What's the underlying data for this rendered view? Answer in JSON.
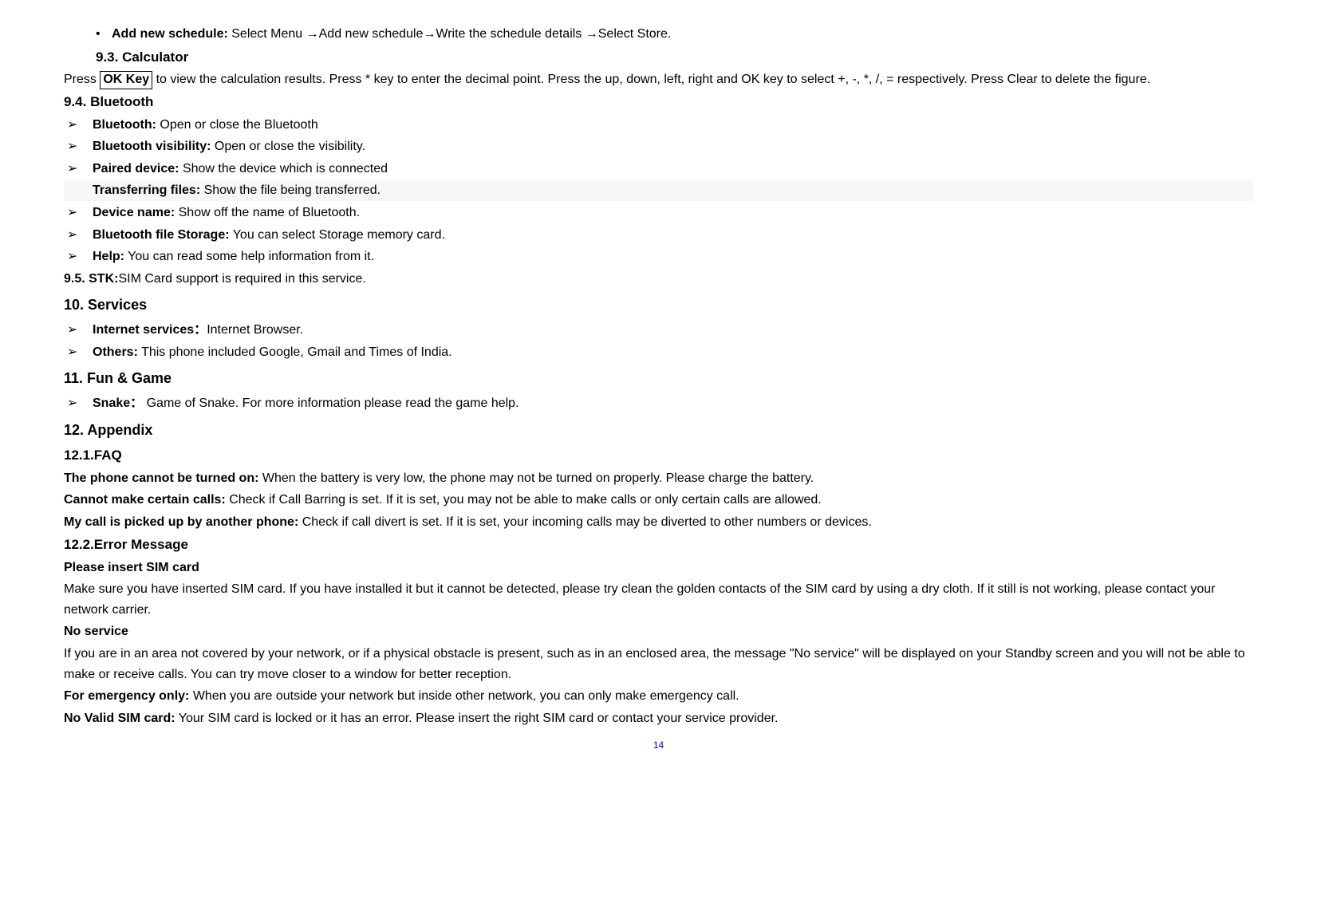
{
  "topBullet": {
    "mark": "•",
    "label": "Add new schedule:",
    "text": " Select Menu  →Add new schedule→Write the schedule details  →Select Store."
  },
  "s93": {
    "num": "9.3. Calculator"
  },
  "calcPara": {
    "pre": "Press ",
    "ok": "OK Key",
    "post": " to view the calculation results. Press * key to enter the decimal point. Press the up, down, left, right and OK key to select +, -, *, /, = respectively. Press Clear to delete the figure."
  },
  "s94": {
    "num": "9.4.   Bluetooth"
  },
  "btItems": [
    {
      "mark": "➢",
      "label": "Bluetooth:",
      "text": " Open or close the Bluetooth"
    },
    {
      "mark": "➢",
      "label": "Bluetooth visibility:",
      "text": " Open or close the visibility."
    },
    {
      "mark": "➢",
      "label": "Paired device:",
      "text": " Show   the device which is connected"
    }
  ],
  "btTransfer": {
    "label": "Transferring files:",
    "text": " Show the file being transferred."
  },
  "btItems2": [
    {
      "mark": "➢",
      "label": "Device name:",
      "text": " Show off the name of Bluetooth."
    },
    {
      "mark": "➢",
      "label": "Bluetooth file Storage:",
      "text": " You can select Storage memory card."
    },
    {
      "mark": "➢",
      "label": "Help:",
      "text": " You can read some help information from it."
    }
  ],
  "s95": {
    "label": "9.5.  STK:",
    "text": "SIM Card support is required in this service."
  },
  "s10": "10. Services",
  "svcItems": [
    {
      "mark": "➢",
      "label": "Internet services：",
      "text": "Internet Browser."
    },
    {
      "mark": "➢",
      "label": "Others:",
      "text": " This phone included Google, Gmail and Times of India."
    }
  ],
  "s11": "11. Fun  &  Game",
  "gameItem": {
    "mark": "➢",
    "label": "Snake：",
    "text": " Game of Snake. For more information please read the game help."
  },
  "s12": "12. Appendix",
  "s121": "12.1.FAQ",
  "faq": [
    {
      "label": "The phone cannot be turned on:",
      "text": " When the battery is very low, the phone may not be turned on properly. Please charge the battery."
    },
    {
      "label": "Cannot make certain calls:",
      "text": " Check if Call Barring is set. If it is set, you may not be able to make calls or only certain calls are allowed."
    },
    {
      "label": "My call is picked up by another phone:",
      "text": " Check if call divert is set. If it is set, your incoming calls may be diverted to other numbers or devices."
    }
  ],
  "s122": "12.2.Error Message",
  "err1h": "Please insert SIM card",
  "err1t": "Make sure you have inserted SIM card. If you have installed it but it cannot be detected, please try clean the golden contacts of the SIM card by using a dry cloth. If it still is not working, please contact your network carrier.",
  "err2h": "No service",
  "err2t": "If you are in an area not covered by your network, or if a physical obstacle is present, such as in an enclosed area, the message \"No service\" will be displayed on your Standby screen and you will not be able to make or receive calls. You can try move closer to a window for better reception.",
  "err3": {
    "label": "For emergency only:",
    "text": " When you are outside your network but inside other network, you can only make emergency call."
  },
  "err4": {
    "label": "No Valid SIM card:",
    "text": " Your SIM card is locked or it has an error. Please insert the right SIM card or contact your service provider."
  },
  "page": "14"
}
